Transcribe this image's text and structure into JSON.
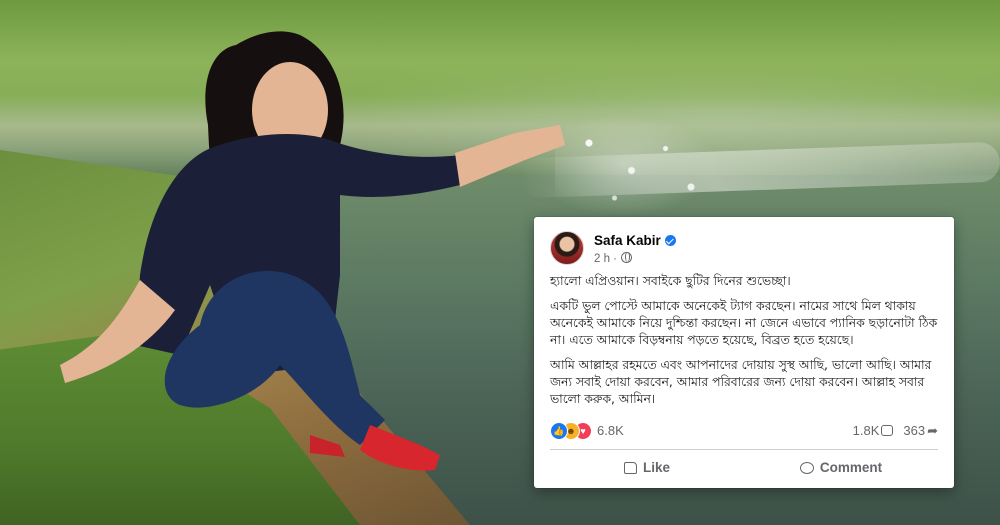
{
  "post": {
    "author": "Safa Kabir",
    "time": "2 h ·",
    "paragraphs": [
      "হ্যালো এপ্রিওয়ান। সবাইকে ছুটির দিনের শুভেচ্ছা।",
      "একটি ভুল পোস্টে আমাকে অনেকেই ট্যাগ করছেন। নামের সাথে মিল থাকায় অনেকেই আমাকে নিয়ে দুশ্চিন্তা করছেন। না জেনে এভাবে প্যানিক ছড়ানোটা ঠিক না। এতে আমাকে বিড়ম্বনায় পড়তে হয়েছে, বিব্রত হতে হয়েছে।",
      "আমি আল্লাহর রহমতে এবং আপনাদের দোয়ায় সুস্থ আছি, ভালো আছি। আমার জন্য সবাই দোয়া করবেন, আমার পরিবারের জন্য দোয়া করবেন। আল্লাহ সবার ভালো করুক, আমিন।"
    ],
    "reactions_count": "6.8K",
    "comments_count": "1.8K",
    "shares_count": "363",
    "like_label": "Like",
    "comment_label": "Comment"
  },
  "icons": {
    "verified": "verified-badge-icon",
    "privacy": "globe-icon",
    "reactions": [
      "like-reaction-icon",
      "haha-reaction-icon",
      "love-reaction-icon"
    ],
    "like": "thumbs-up-icon",
    "comment": "comment-icon",
    "share": "share-icon"
  },
  "colors": {
    "facebook_blue": "#1877f2",
    "secondary_text": "#65676b",
    "love_red": "#f33e58",
    "haha_yellow": "#f7b125"
  }
}
